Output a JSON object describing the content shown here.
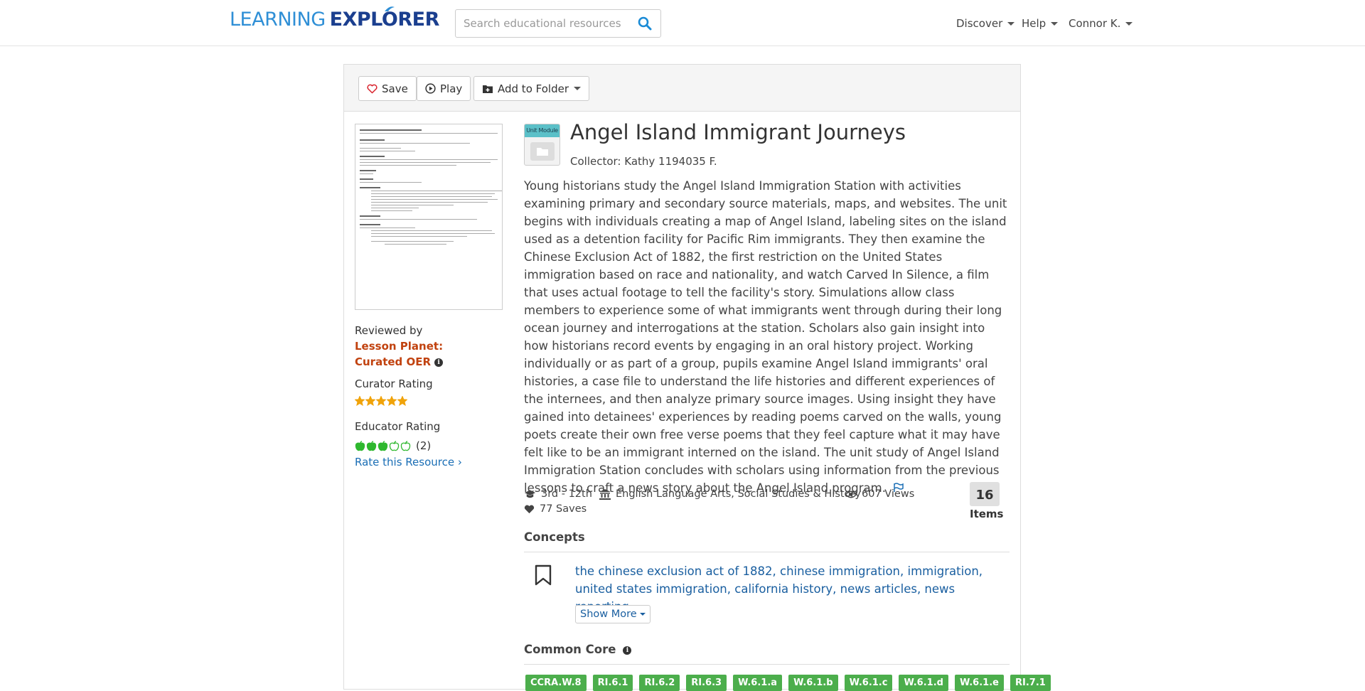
{
  "header": {
    "logo_left": "LEARNING",
    "logo_right": "EXPLORER",
    "search_placeholder": "Search educational resources",
    "nav": [
      {
        "label": "Discover"
      },
      {
        "label": "Help"
      },
      {
        "label": "Connor K."
      }
    ]
  },
  "toolbar": {
    "save_label": "Save",
    "play_label": "Play",
    "add_folder_label": "Add to Folder"
  },
  "sidebar": {
    "reviewed_by": "Reviewed by",
    "reviewer_line1": "Lesson Planet:",
    "reviewer_line2": "Curated OER",
    "curator_rating_label": "Curator Rating",
    "curator_rating": 5,
    "educator_rating_label": "Educator Rating",
    "educator_rating": 3,
    "educator_rating_count": "(2)",
    "rate_link": "Rate this Resource"
  },
  "resource": {
    "type_badge": "Unit Module",
    "title": "Angel Island Immigrant Journeys",
    "collector": "Collector: Kathy 1194035 F.",
    "description": "Young historians study the Angel Island Immigration Station with activities examining primary and secondary source materials, maps, and websites. The unit begins with individuals creating a map of Angel Island, labeling sites on the island used as a detention facility for Pacific Rim immigrants. They then examine the Chinese Exclusion Act of 1882, the first restriction on the United States immigration based on race and nationality, and watch Carved In Silence, a film that uses actual footage to tell the facility's story. Simulations allow class members to experience some of what immigrants went through during their long ocean journey and interrogations at the station. Scholars also gain insight into how historians record events by engaging in an oral history project. Working individually or as part of a group, pupils examine Angel Island immigrants' oral histories, a case file to understand the life histories and different experiences of the internees, and then analyze primary source images. Using insight they have gained into detainees' experiences by reading poems carved on the walls, young poets create their own free verse poems that they feel capture what it may have felt like to be an immigrant interned on the island. The unit study of Angel Island Immigration Station concludes with scholars using information from the previous lessons to craft a news story about the Angel Island program.",
    "grades": "3rd - 12th",
    "subjects": "English Language Arts, Social Studies & History",
    "views": "607 Views",
    "saves": "77 Saves",
    "items_count": "16",
    "items_label": "Items"
  },
  "concepts": {
    "title": "Concepts",
    "list": "the chinese exclusion act of 1882, chinese immigration, immigration, united states immigration, california history, news articles, news reporting,...",
    "show_more": "Show More"
  },
  "common_core": {
    "title": "Common Core",
    "tags": [
      "CCRA.W.8",
      "RI.6.1",
      "RI.6.2",
      "RI.6.3",
      "W.6.1.a",
      "W.6.1.b",
      "W.6.1.c",
      "W.6.1.d",
      "W.6.1.e",
      "RI.7.1"
    ]
  },
  "colors": {
    "accent_blue": "#1a6eb5",
    "reviewer_orange": "#c1420f",
    "star_orange": "#f0a30a",
    "apple_green": "#2eb82e",
    "cc_tag_green": "#4cae4c"
  }
}
